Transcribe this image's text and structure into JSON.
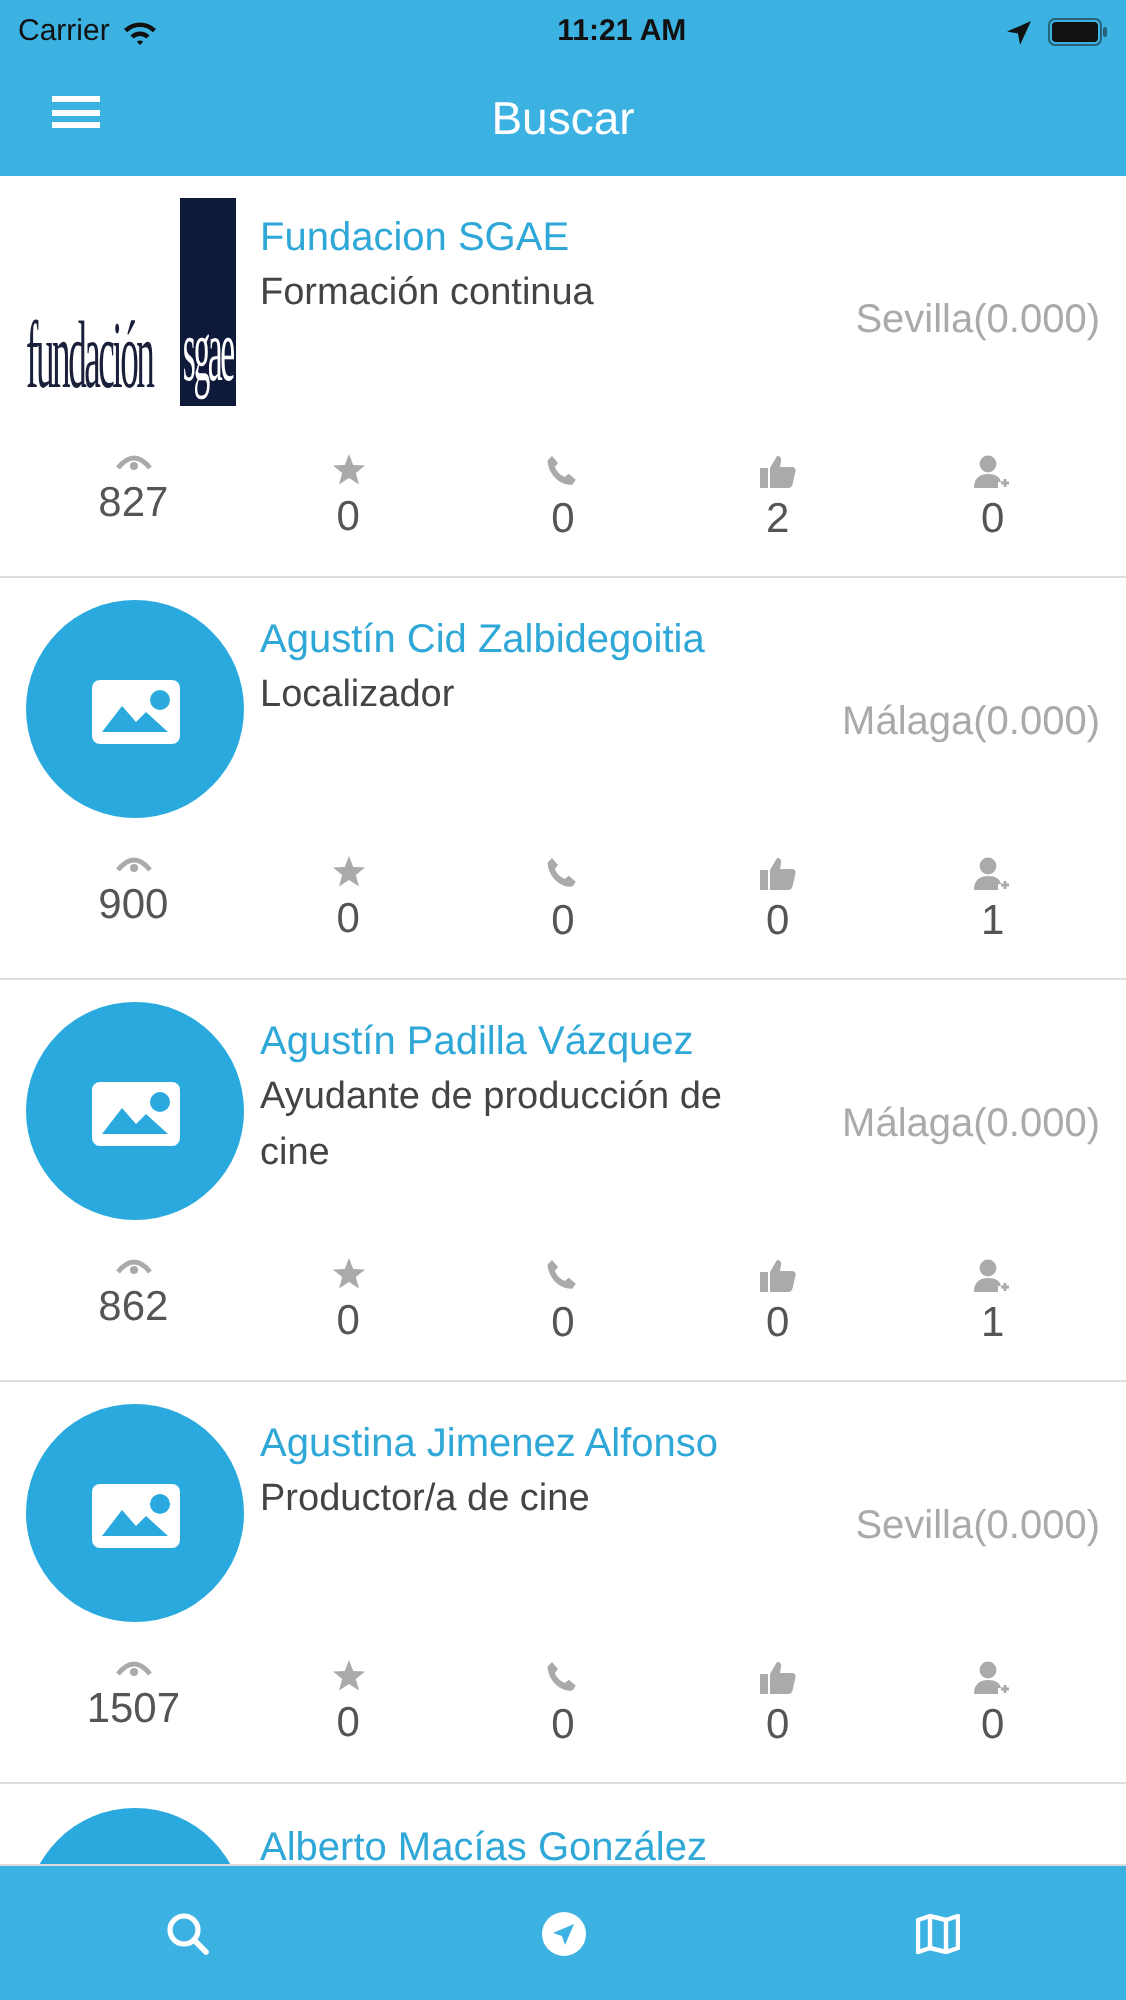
{
  "status_bar": {
    "carrier": "Carrier",
    "time": "11:21 AM"
  },
  "header": {
    "title": "Buscar"
  },
  "results": [
    {
      "avatar": {
        "kind": "logo",
        "text": "fundación",
        "highlight": "sgae"
      },
      "name": "Fundacion SGAE",
      "partial": false,
      "role": "Formación continua",
      "location": "Sevilla(0.000)",
      "views": "827",
      "stars": "0",
      "calls": "0",
      "likes": "2",
      "contacts": "0"
    },
    {
      "avatar": {
        "kind": "placeholder"
      },
      "name": "Agustín Cid Zalbidegoitia",
      "partial": false,
      "role": "Localizador",
      "location": "Málaga(0.000)",
      "views": "900",
      "stars": "0",
      "calls": "0",
      "likes": "0",
      "contacts": "1"
    },
    {
      "avatar": {
        "kind": "placeholder"
      },
      "name": "Agustín Padilla Vázquez",
      "partial": false,
      "role": "Ayudante de producción de cine",
      "location": "Málaga(0.000)",
      "views": "862",
      "stars": "0",
      "calls": "0",
      "likes": "0",
      "contacts": "1"
    },
    {
      "avatar": {
        "kind": "placeholder"
      },
      "name": "Agustina Jimenez Alfonso",
      "partial": false,
      "role": "Productor/a de cine",
      "location": "Sevilla(0.000)",
      "views": "1507",
      "stars": "0",
      "calls": "0",
      "likes": "0",
      "contacts": "0"
    },
    {
      "avatar": {
        "kind": "placeholder"
      },
      "name": "Alberto Macías González",
      "partial": true
    }
  ],
  "tab_bar": {
    "tabs": [
      {
        "kind": "search",
        "selected": false
      },
      {
        "kind": "navigate",
        "selected": false
      },
      {
        "kind": "map",
        "selected": false
      }
    ]
  }
}
